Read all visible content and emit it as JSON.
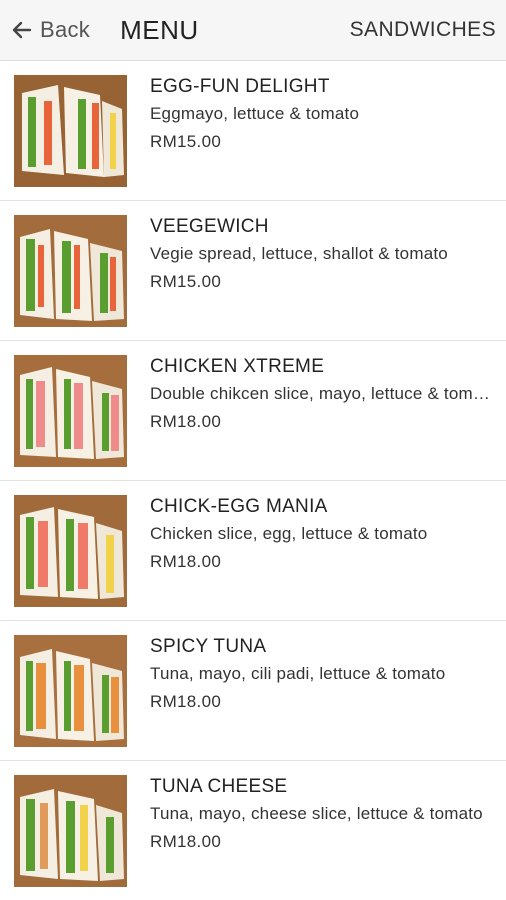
{
  "header": {
    "back_label": "Back",
    "title": "MENU",
    "category": "SANDWICHES"
  },
  "items": [
    {
      "name": "EGG-FUN DELIGHT",
      "description": "Eggmayo, lettuce & tomato",
      "price": "RM15.00"
    },
    {
      "name": "VEEGEWICH",
      "description": "Vegie spread, lettuce, shallot & tomato",
      "price": "RM15.00"
    },
    {
      "name": "CHICKEN XTREME",
      "description": "Double chikcen slice, mayo, lettuce & tomato",
      "price": "RM18.00"
    },
    {
      "name": "CHICK-EGG MANIA",
      "description": "Chicken slice, egg, lettuce & tomato",
      "price": "RM18.00"
    },
    {
      "name": "SPICY TUNA",
      "description": "Tuna, mayo, cili padi, lettuce & tomato",
      "price": "RM18.00"
    },
    {
      "name": "TUNA CHEESE",
      "description": "Tuna, mayo, cheese slice, lettuce & tomato",
      "price": "RM18.00"
    }
  ],
  "colors": {
    "header_bg": "#f6f6f6",
    "divider": "#e2e2e2",
    "wood": "#a06a3a",
    "bread": "#f4efe2",
    "lettuce": "#5a9e2f",
    "tomato": "#e8643a"
  }
}
